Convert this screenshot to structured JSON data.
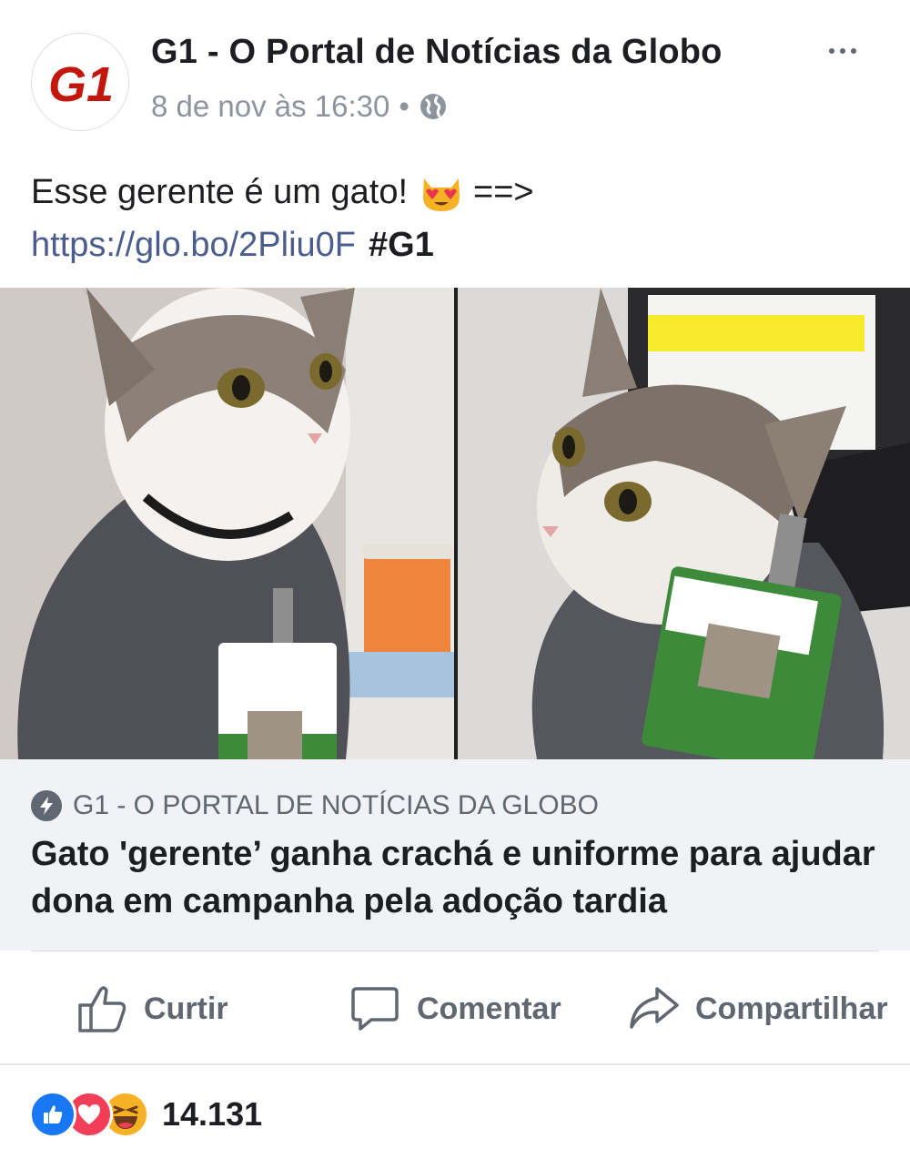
{
  "post": {
    "page_name": "G1 - O Portal de Notícias da Globo",
    "timestamp": "8 de nov às 16:30",
    "separator": "•",
    "privacy_icon": "globe-icon",
    "avatar_logo": "G1",
    "text_line1": "Esse gerente é um gato!",
    "arrow": "==>",
    "link": "https://glo.bo/2Pliu0F",
    "hashtag": "#G1"
  },
  "preview": {
    "source": "G1 - O PORTAL DE NOTÍCIAS DA GLOBO",
    "headline": "Gato 'gerente’ ganha crachá e uniforme para ajudar dona em campanha pela adoção tardia"
  },
  "actions": {
    "like": "Curtir",
    "comment": "Comentar",
    "share": "Compartilhar"
  },
  "reactions": {
    "icons": [
      "like-icon",
      "love-icon",
      "haha-icon"
    ],
    "count": "14.131"
  },
  "colors": {
    "g1_red": "#c4170c",
    "link": "#4b5c8f",
    "like_blue": "#1877f2",
    "love_red": "#f33e58",
    "haha_yellow": "#f7b125"
  }
}
